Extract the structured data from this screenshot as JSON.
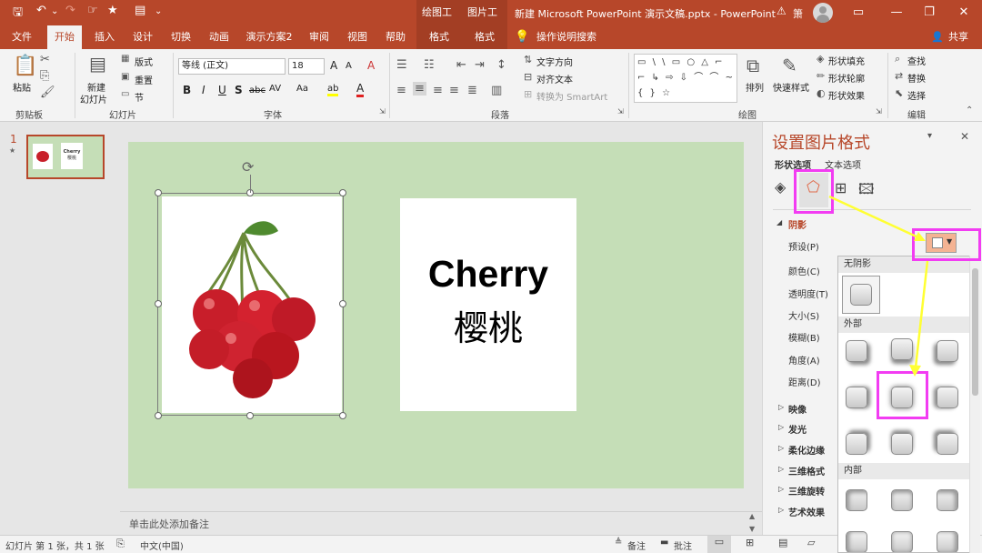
{
  "quick_access": {
    "save": "🖫",
    "undo": "↶",
    "undo_arrow": "⌄",
    "redo": "↷",
    "touch": "☞",
    "star": "★",
    "present": "▤",
    "more": "⌄"
  },
  "context_tabs": {
    "drawing_tools": "绘图工具",
    "picture_tools": "图片工具"
  },
  "window": {
    "title": "新建 Microsoft PowerPoint 演示文稿.pptx  -  PowerPoint",
    "warning": "⚠",
    "user": "箫",
    "ribbon_display": "▭",
    "minimize": "—",
    "restore": "❐",
    "close": "✕"
  },
  "tabs": [
    "文件",
    "开始",
    "插入",
    "设计",
    "切换",
    "动画",
    "演示方案2",
    "审阅",
    "视图",
    "帮助",
    "格式",
    "格式"
  ],
  "tell_me": "操作说明搜索",
  "share": "共享",
  "ribbon": {
    "clipboard": {
      "paste": "粘贴",
      "label": "剪贴板"
    },
    "slides": {
      "new_slide": "新建",
      "new_slide2": "幻灯片",
      "layout": "版式",
      "reset": "重置",
      "section": "节",
      "label": "幻灯片"
    },
    "font": {
      "name": "等线 (正文)",
      "size": "18",
      "grow": "A",
      "shrink": "A",
      "clear": "A",
      "bold": "B",
      "italic": "I",
      "underline": "U",
      "shadow": "S",
      "strike": "abc",
      "spacing": "AV",
      "case": "Aa",
      "highlight": "ab",
      "color": "A",
      "label": "字体"
    },
    "paragraph": {
      "text_dir": "文字方向",
      "align_text": "对齐文本",
      "smartart": "转换为 SmartArt",
      "label": "段落"
    },
    "drawing": {
      "shapes": "▭ \\ \\ ▭ ○ △ ⌐ ⌐ ↳ ⇨ ⇩ ⌒ ⌒ ~ { } ☆",
      "arrange": "排列",
      "quick_styles": "快速样式",
      "fill": "形状填充",
      "outline": "形状轮廓",
      "effects": "形状效果",
      "label": "绘图"
    },
    "editing": {
      "find": "查找",
      "replace": "替换",
      "select": "选择",
      "label": "编辑"
    }
  },
  "thumbnail": {
    "number": "1",
    "star": "★",
    "word": "Cherry",
    "zh": "樱桃"
  },
  "slide": {
    "card_en": "Cherry",
    "card_zh": "樱桃",
    "rotate": "⟳"
  },
  "notes_placeholder": "单击此处添加备注",
  "status": {
    "slide_info": "幻灯片 第 1 张，共 1 张",
    "language": "中文(中国)",
    "notes": "备注",
    "comments": "批注"
  },
  "panel": {
    "title": "设置图片格式",
    "shape_options": "形状选项",
    "text_options": "文本选项",
    "shadow": "阴影",
    "preset": "预设(P)",
    "color": "颜色(C)",
    "transparency": "透明度(T)",
    "size": "大小(S)",
    "blur": "模糊(B)",
    "angle": "角度(A)",
    "distance": "距离(D)",
    "reflection": "映像",
    "glow": "发光",
    "soft_edges": "柔化边缘",
    "bevel": "三维格式",
    "rotation3d": "三维旋转",
    "artistic": "艺术效果",
    "dropdown": {
      "no_shadow": "无阴影",
      "outer": "外部",
      "inner": "内部"
    }
  },
  "colors": {
    "accent": "#b7472a",
    "slide_bg": "#c5deb7",
    "highlight": "#f23cf2",
    "arrow": "#ffff33"
  }
}
